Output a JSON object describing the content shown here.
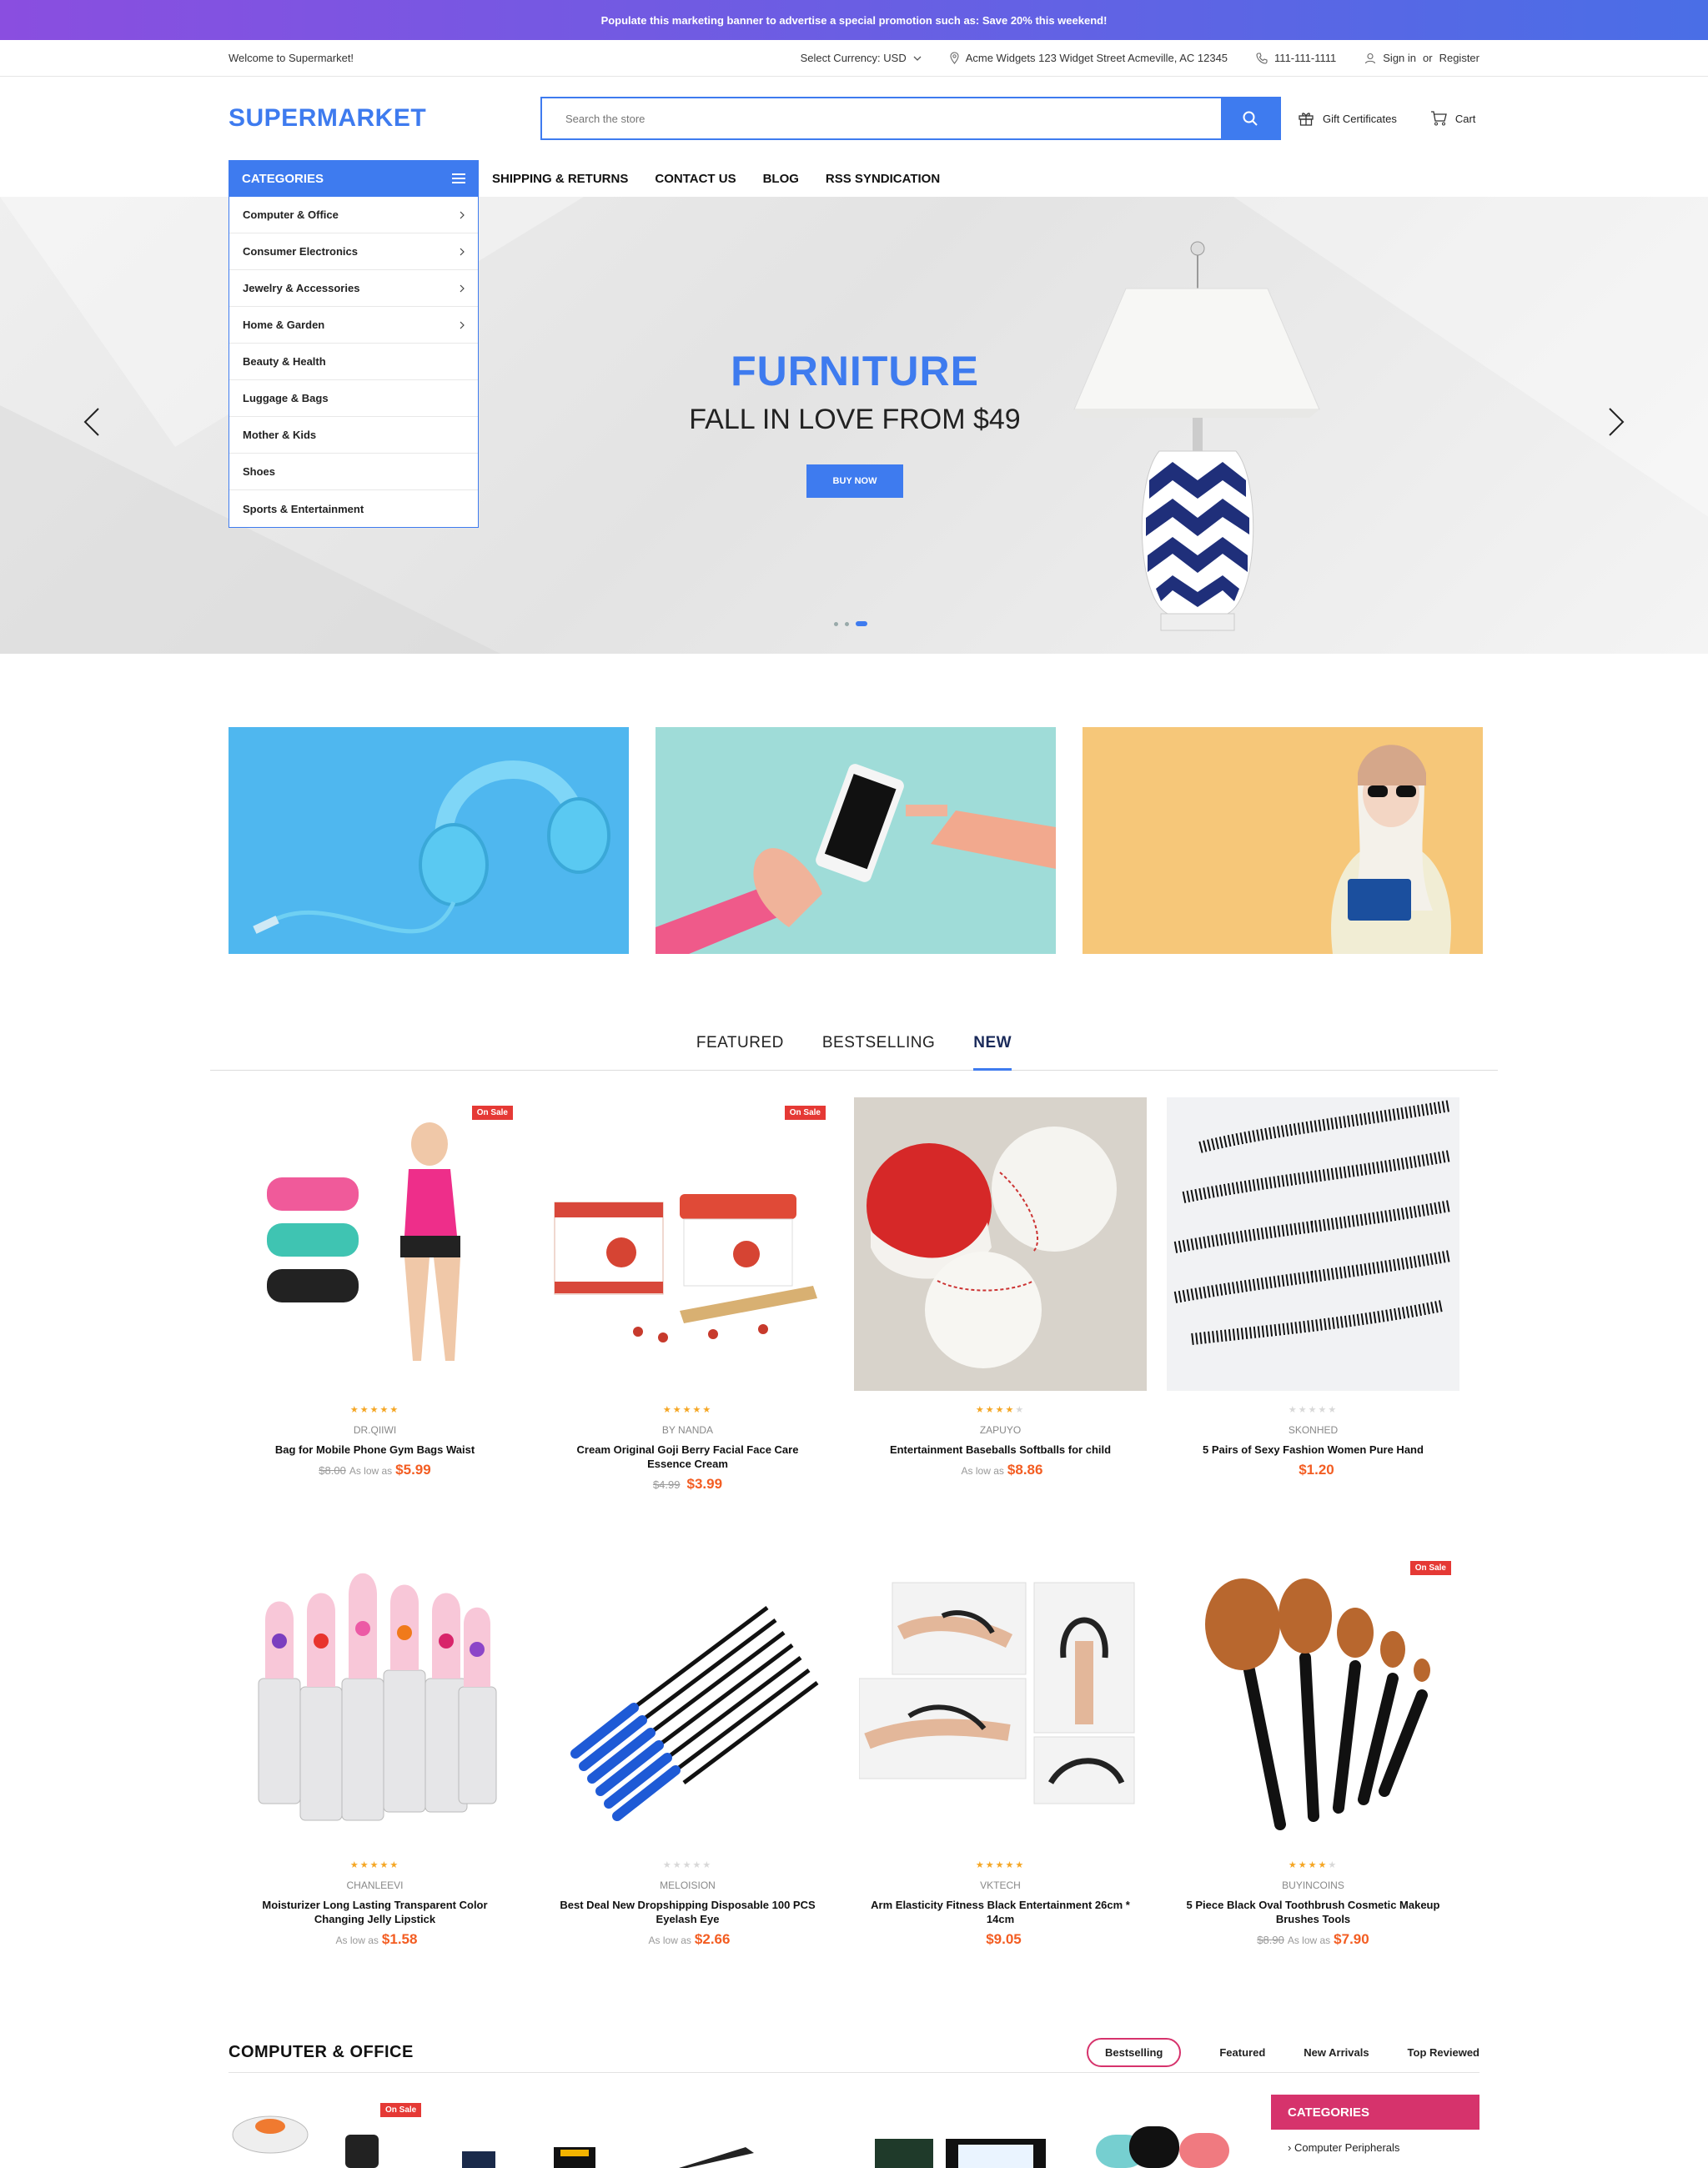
{
  "promo": {
    "text": "Populate this marketing banner to advertise a special promotion such as: Save 20% this weekend!"
  },
  "topbar": {
    "welcome": "Welcome to Supermarket!",
    "currency": "Select Currency: USD",
    "address": "Acme Widgets 123 Widget Street Acmeville, AC 12345",
    "phone": "111-111-1111",
    "signin": "Sign in",
    "or": "or",
    "register": "Register"
  },
  "header": {
    "logo": "SUPERMARKET",
    "search_placeholder": "Search the store",
    "gift": "Gift Certificates",
    "cart": "Cart"
  },
  "nav": {
    "categories_label": "CATEGORIES",
    "links": [
      "SHIPPING & RETURNS",
      "CONTACT US",
      "BLOG",
      "RSS SYNDICATION"
    ]
  },
  "categories": [
    {
      "label": "Computer & Office",
      "has_sub": true
    },
    {
      "label": "Consumer Electronics",
      "has_sub": true
    },
    {
      "label": "Jewelry & Accessories",
      "has_sub": true
    },
    {
      "label": "Home & Garden",
      "has_sub": true
    },
    {
      "label": "Beauty & Health",
      "has_sub": false
    },
    {
      "label": "Luggage & Bags",
      "has_sub": false
    },
    {
      "label": "Mother & Kids",
      "has_sub": false
    },
    {
      "label": "Shoes",
      "has_sub": false
    },
    {
      "label": "Sports & Entertainment",
      "has_sub": false
    }
  ],
  "hero": {
    "title": "FURNITURE",
    "subtitle": "FALL IN LOVE FROM $49",
    "button": "BUY NOW",
    "slide_count": 3,
    "active_slide": 3
  },
  "product_tabs": [
    "FEATURED",
    "BESTSELLING",
    "NEW"
  ],
  "product_tabs_active": 2,
  "products": [
    {
      "brand": "DR.QIIWI",
      "name": "Bag for Mobile Phone Gym Bags Waist",
      "old": "$8.00",
      "low": "As low as",
      "price": "$5.99",
      "rating": 5,
      "sale": "On Sale"
    },
    {
      "brand": "BY NANDA",
      "name": "Cream Original Goji Berry Facial Face Care Essence Cream",
      "old": "$4.99",
      "low": "",
      "price": "$3.99",
      "rating": 5,
      "sale": "On Sale"
    },
    {
      "brand": "ZAPUYO",
      "name": "Entertainment Baseballs Softballs for child",
      "old": "",
      "low": "As low as",
      "price": "$8.86",
      "rating": 4,
      "sale": ""
    },
    {
      "brand": "SKONHED",
      "name": "5 Pairs of Sexy Fashion Women Pure Hand",
      "old": "",
      "low": "",
      "price": "$1.20",
      "rating": 0,
      "sale": ""
    },
    {
      "brand": "CHANLEEVI",
      "name": "Moisturizer Long Lasting Transparent Color Changing Jelly Lipstick",
      "old": "",
      "low": "As low as",
      "price": "$1.58",
      "rating": 5,
      "sale": ""
    },
    {
      "brand": "MELOISION",
      "name": "Best Deal New Dropshipping Disposable 100 PCS Eyelash Eye",
      "old": "",
      "low": "As low as",
      "price": "$2.66",
      "rating": 0,
      "sale": ""
    },
    {
      "brand": "VKTECH",
      "name": "Arm Elasticity Fitness Black Entertainment 26cm * 14cm",
      "old": "",
      "low": "",
      "price": "$9.05",
      "rating": 5,
      "sale": ""
    },
    {
      "brand": "BUYINCOINS",
      "name": "5 Piece Black Oval Toothbrush Cosmetic Makeup Brushes Tools",
      "old": "$8.90",
      "low": "As low as",
      "price": "$7.90",
      "rating": 4,
      "sale": "On Sale"
    }
  ],
  "section2": {
    "title": "COMPUTER & OFFICE",
    "tabs": [
      "Bestselling",
      "Featured",
      "New Arrivals",
      "Top Reviewed"
    ],
    "sale": "On Sale",
    "side_title": "CATEGORIES",
    "side_item": "Computer Peripherals"
  },
  "colors": {
    "accent": "#3e7bef",
    "sale": "#e53935",
    "price": "#f35d22",
    "pink": "#d6336c",
    "star": "#f5a623"
  }
}
